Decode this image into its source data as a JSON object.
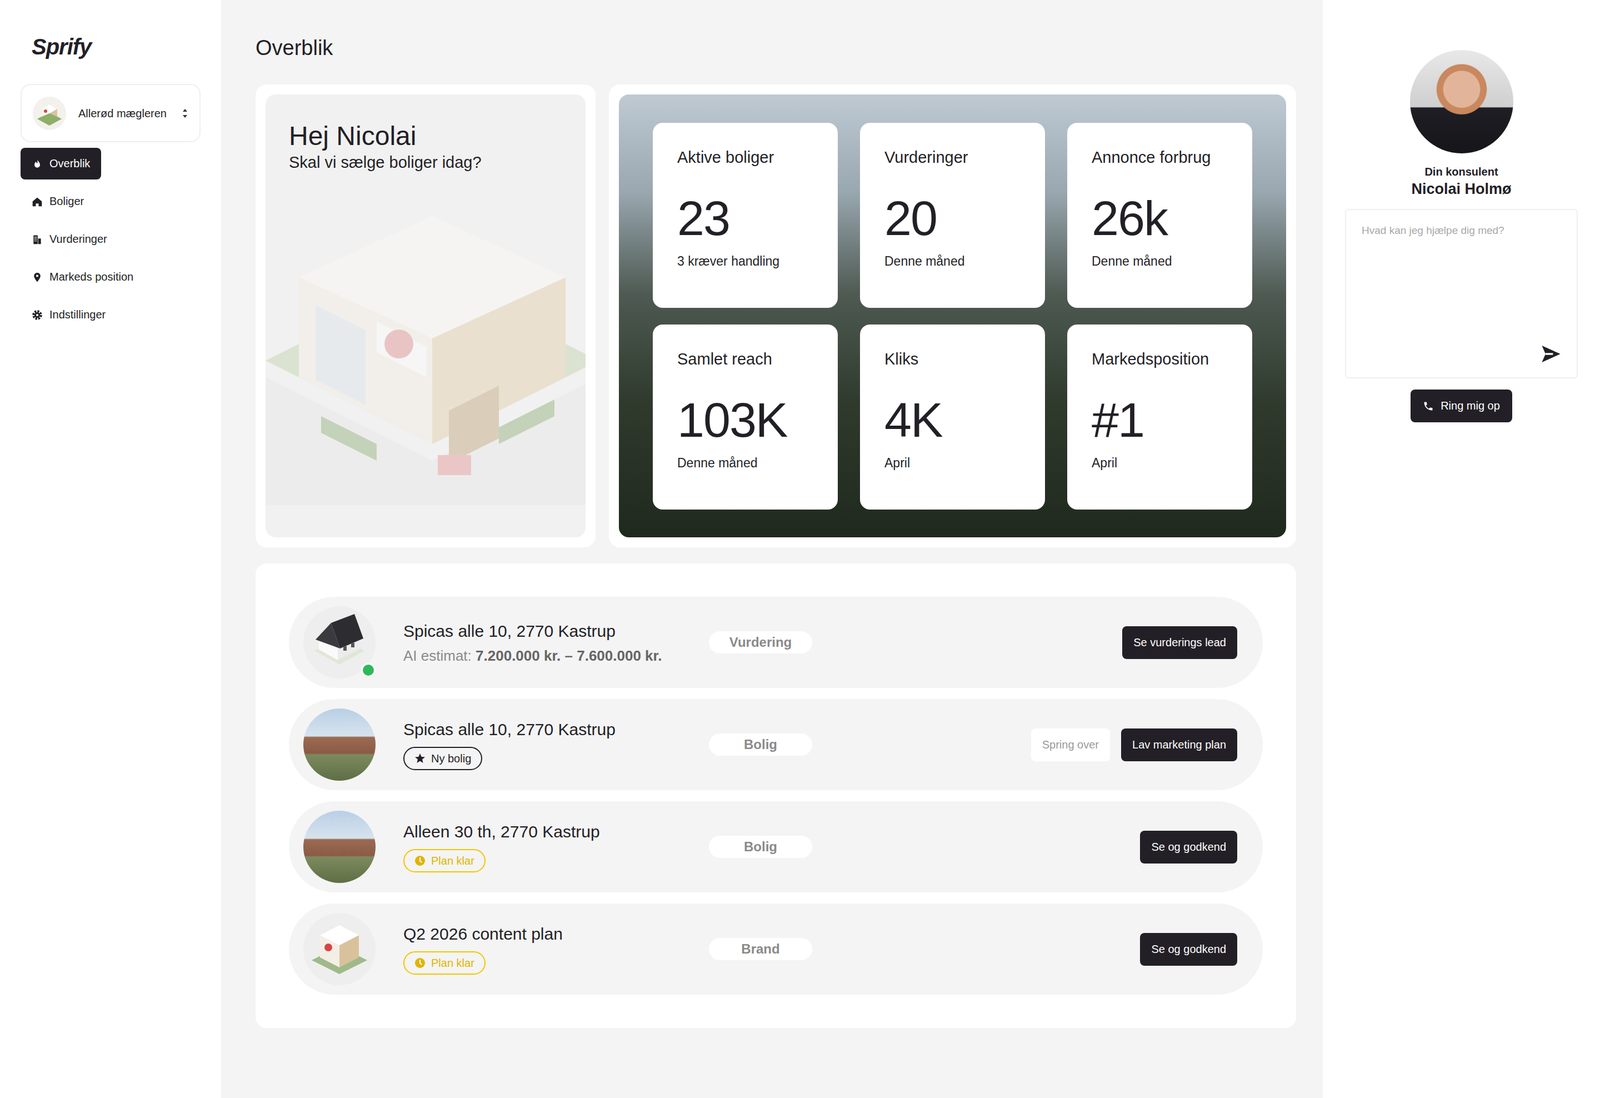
{
  "app": {
    "logo": "Sprify"
  },
  "account": {
    "name": "Allerød mægleren"
  },
  "sidebar": {
    "items": [
      {
        "label": "Overblik",
        "selected": true
      },
      {
        "label": "Boliger",
        "selected": false
      },
      {
        "label": "Vurderinger",
        "selected": false
      },
      {
        "label": "Markeds position",
        "selected": false
      },
      {
        "label": "Indstillinger",
        "selected": false
      }
    ]
  },
  "page": {
    "title": "Overblik"
  },
  "greeting": {
    "title": "Hej Nicolai",
    "subtitle": "Skal vi sælge boliger idag?"
  },
  "stats": [
    {
      "label": "Aktive boliger",
      "value": "23",
      "note": "3 kræver handling"
    },
    {
      "label": "Vurderinger",
      "value": "20",
      "note": "Denne måned"
    },
    {
      "label": "Annonce forbrug",
      "value": "26k",
      "note": "Denne måned"
    },
    {
      "label": "Samlet reach",
      "value": "103K",
      "note": "Denne måned"
    },
    {
      "label": "Kliks",
      "value": "4K",
      "note": "April"
    },
    {
      "label": "Markedsposition",
      "value": "#1",
      "note": "April"
    }
  ],
  "tasks": [
    {
      "title": "Spicas alle 10, 2770 Kastrup",
      "thumb": "house",
      "online": true,
      "estimate": {
        "label": "AI estimat:",
        "value": "7.200.000 kr. – 7.600.000 kr."
      },
      "badge": null,
      "tag": "Vurdering",
      "buttons": [
        {
          "label": "Se vurderings lead",
          "primary": true
        }
      ]
    },
    {
      "title": "Spicas alle 10, 2770 Kastrup",
      "thumb": "photo",
      "online": false,
      "estimate": null,
      "badge": {
        "label": "Ny bolig",
        "kind": "new"
      },
      "tag": "Bolig",
      "buttons": [
        {
          "label": "Spring over",
          "primary": false
        },
        {
          "label": "Lav marketing plan",
          "primary": true
        }
      ]
    },
    {
      "title": "Alleen 30 th, 2770 Kastrup",
      "thumb": "photo",
      "online": false,
      "estimate": null,
      "badge": {
        "label": "Plan klar",
        "kind": "ready"
      },
      "tag": "Bolig",
      "buttons": [
        {
          "label": "Se og godkend",
          "primary": true
        }
      ]
    },
    {
      "title": "Q2 2026 content plan",
      "thumb": "office",
      "online": false,
      "estimate": null,
      "badge": {
        "label": "Plan klar",
        "kind": "ready"
      },
      "tag": "Brand",
      "buttons": [
        {
          "label": "Se og godkend",
          "primary": true
        }
      ]
    }
  ],
  "consultant": {
    "caption": "Din konsulent",
    "name": "Nicolai Holmø",
    "placeholder": "Hvad kan jeg hjælpe dig med?",
    "call_button": "Ring mig op"
  }
}
